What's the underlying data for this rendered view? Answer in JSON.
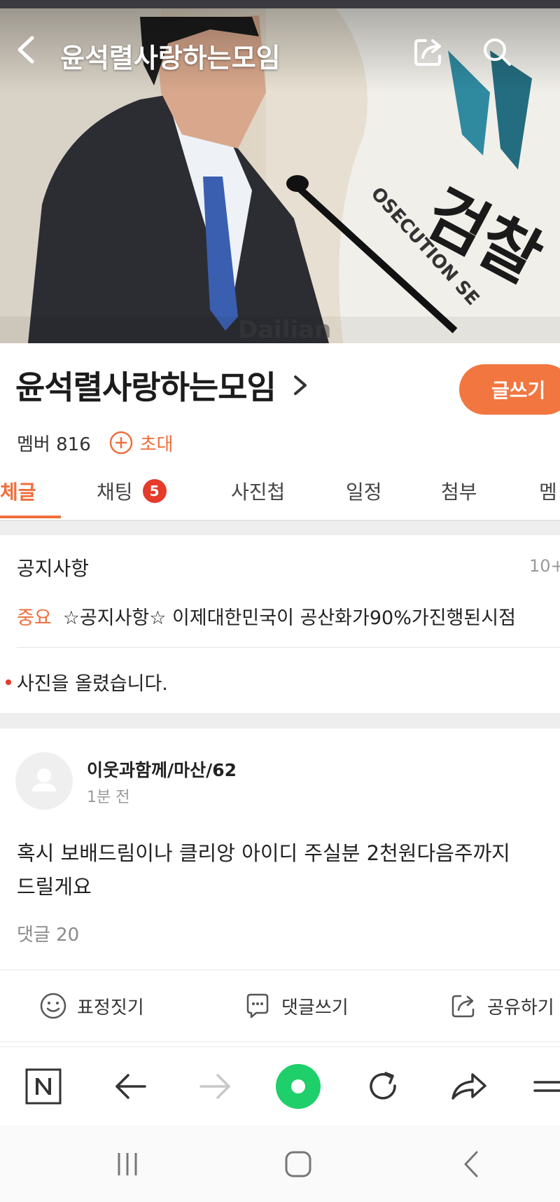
{
  "header": {
    "title": "윤석렬사랑하는모임",
    "back_icon": "chevron-left-icon",
    "share_icon": "share-icon",
    "search_icon": "search-icon",
    "photo_watermark": "Dailian",
    "flag_text_ko": "검찰",
    "flag_text_en": "OSECUTION SE"
  },
  "club": {
    "name": "윤석렬사랑하는모임",
    "write_label": "글쓰기",
    "member_label": "멤버 816",
    "invite_label": "초대"
  },
  "tabs": [
    {
      "label": "체글",
      "active": true
    },
    {
      "label": "채팅",
      "badge": "5"
    },
    {
      "label": "사진첩"
    },
    {
      "label": "일정"
    },
    {
      "label": "첨부"
    },
    {
      "label": "멤!"
    }
  ],
  "notice": {
    "title": "공지사항",
    "count": "10+",
    "tag": "중요",
    "item_text": "☆공지사항☆ 이제대한민국이 공산화가90%가진행된시점",
    "photo_notice": "사진을 올렸습니다."
  },
  "post": {
    "author": "이웃과함께/마산/62",
    "time": "1분 전",
    "body_line1": "혹시 보배드림이나 클리앙 아이디 주실분 2천원다음주까지",
    "body_line2": "드릴게요",
    "comment_count": "댓글 20",
    "actions": {
      "react": "표정짓기",
      "comment": "댓글쓰기",
      "share": "공유하기"
    }
  },
  "browser_toolbar": [
    "naver-icon",
    "back-arrow-icon",
    "forward-arrow-icon",
    "green-dot-icon",
    "refresh-icon",
    "share-arrow-icon",
    "menu-icon"
  ],
  "system_nav": [
    "recent-apps-icon",
    "home-icon",
    "back-icon"
  ],
  "colors": {
    "accent": "#ef6f3c",
    "badge": "#e63a2a",
    "green": "#1fcf6a"
  }
}
